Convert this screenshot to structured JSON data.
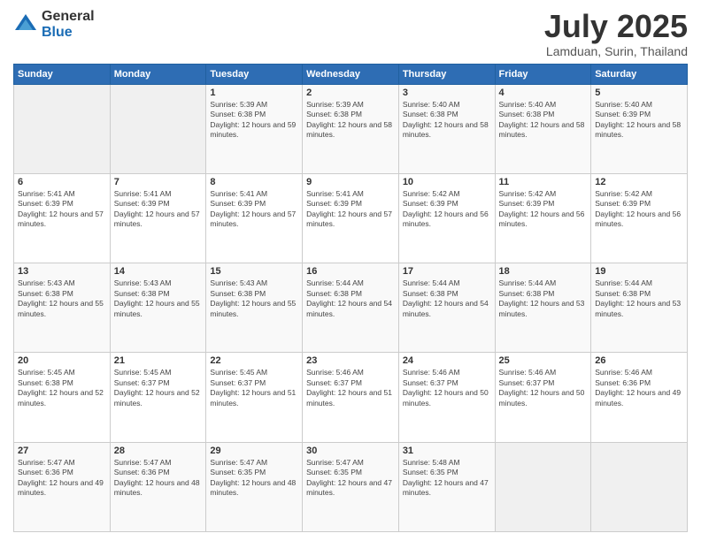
{
  "logo": {
    "general": "General",
    "blue": "Blue"
  },
  "header": {
    "month": "July 2025",
    "location": "Lamduan, Surin, Thailand"
  },
  "weekdays": [
    "Sunday",
    "Monday",
    "Tuesday",
    "Wednesday",
    "Thursday",
    "Friday",
    "Saturday"
  ],
  "weeks": [
    [
      {
        "day": "",
        "sunrise": "",
        "sunset": "",
        "daylight": ""
      },
      {
        "day": "",
        "sunrise": "",
        "sunset": "",
        "daylight": ""
      },
      {
        "day": "1",
        "sunrise": "Sunrise: 5:39 AM",
        "sunset": "Sunset: 6:38 PM",
        "daylight": "Daylight: 12 hours and 59 minutes."
      },
      {
        "day": "2",
        "sunrise": "Sunrise: 5:39 AM",
        "sunset": "Sunset: 6:38 PM",
        "daylight": "Daylight: 12 hours and 58 minutes."
      },
      {
        "day": "3",
        "sunrise": "Sunrise: 5:40 AM",
        "sunset": "Sunset: 6:38 PM",
        "daylight": "Daylight: 12 hours and 58 minutes."
      },
      {
        "day": "4",
        "sunrise": "Sunrise: 5:40 AM",
        "sunset": "Sunset: 6:38 PM",
        "daylight": "Daylight: 12 hours and 58 minutes."
      },
      {
        "day": "5",
        "sunrise": "Sunrise: 5:40 AM",
        "sunset": "Sunset: 6:39 PM",
        "daylight": "Daylight: 12 hours and 58 minutes."
      }
    ],
    [
      {
        "day": "6",
        "sunrise": "Sunrise: 5:41 AM",
        "sunset": "Sunset: 6:39 PM",
        "daylight": "Daylight: 12 hours and 57 minutes."
      },
      {
        "day": "7",
        "sunrise": "Sunrise: 5:41 AM",
        "sunset": "Sunset: 6:39 PM",
        "daylight": "Daylight: 12 hours and 57 minutes."
      },
      {
        "day": "8",
        "sunrise": "Sunrise: 5:41 AM",
        "sunset": "Sunset: 6:39 PM",
        "daylight": "Daylight: 12 hours and 57 minutes."
      },
      {
        "day": "9",
        "sunrise": "Sunrise: 5:41 AM",
        "sunset": "Sunset: 6:39 PM",
        "daylight": "Daylight: 12 hours and 57 minutes."
      },
      {
        "day": "10",
        "sunrise": "Sunrise: 5:42 AM",
        "sunset": "Sunset: 6:39 PM",
        "daylight": "Daylight: 12 hours and 56 minutes."
      },
      {
        "day": "11",
        "sunrise": "Sunrise: 5:42 AM",
        "sunset": "Sunset: 6:39 PM",
        "daylight": "Daylight: 12 hours and 56 minutes."
      },
      {
        "day": "12",
        "sunrise": "Sunrise: 5:42 AM",
        "sunset": "Sunset: 6:39 PM",
        "daylight": "Daylight: 12 hours and 56 minutes."
      }
    ],
    [
      {
        "day": "13",
        "sunrise": "Sunrise: 5:43 AM",
        "sunset": "Sunset: 6:38 PM",
        "daylight": "Daylight: 12 hours and 55 minutes."
      },
      {
        "day": "14",
        "sunrise": "Sunrise: 5:43 AM",
        "sunset": "Sunset: 6:38 PM",
        "daylight": "Daylight: 12 hours and 55 minutes."
      },
      {
        "day": "15",
        "sunrise": "Sunrise: 5:43 AM",
        "sunset": "Sunset: 6:38 PM",
        "daylight": "Daylight: 12 hours and 55 minutes."
      },
      {
        "day": "16",
        "sunrise": "Sunrise: 5:44 AM",
        "sunset": "Sunset: 6:38 PM",
        "daylight": "Daylight: 12 hours and 54 minutes."
      },
      {
        "day": "17",
        "sunrise": "Sunrise: 5:44 AM",
        "sunset": "Sunset: 6:38 PM",
        "daylight": "Daylight: 12 hours and 54 minutes."
      },
      {
        "day": "18",
        "sunrise": "Sunrise: 5:44 AM",
        "sunset": "Sunset: 6:38 PM",
        "daylight": "Daylight: 12 hours and 53 minutes."
      },
      {
        "day": "19",
        "sunrise": "Sunrise: 5:44 AM",
        "sunset": "Sunset: 6:38 PM",
        "daylight": "Daylight: 12 hours and 53 minutes."
      }
    ],
    [
      {
        "day": "20",
        "sunrise": "Sunrise: 5:45 AM",
        "sunset": "Sunset: 6:38 PM",
        "daylight": "Daylight: 12 hours and 52 minutes."
      },
      {
        "day": "21",
        "sunrise": "Sunrise: 5:45 AM",
        "sunset": "Sunset: 6:37 PM",
        "daylight": "Daylight: 12 hours and 52 minutes."
      },
      {
        "day": "22",
        "sunrise": "Sunrise: 5:45 AM",
        "sunset": "Sunset: 6:37 PM",
        "daylight": "Daylight: 12 hours and 51 minutes."
      },
      {
        "day": "23",
        "sunrise": "Sunrise: 5:46 AM",
        "sunset": "Sunset: 6:37 PM",
        "daylight": "Daylight: 12 hours and 51 minutes."
      },
      {
        "day": "24",
        "sunrise": "Sunrise: 5:46 AM",
        "sunset": "Sunset: 6:37 PM",
        "daylight": "Daylight: 12 hours and 50 minutes."
      },
      {
        "day": "25",
        "sunrise": "Sunrise: 5:46 AM",
        "sunset": "Sunset: 6:37 PM",
        "daylight": "Daylight: 12 hours and 50 minutes."
      },
      {
        "day": "26",
        "sunrise": "Sunrise: 5:46 AM",
        "sunset": "Sunset: 6:36 PM",
        "daylight": "Daylight: 12 hours and 49 minutes."
      }
    ],
    [
      {
        "day": "27",
        "sunrise": "Sunrise: 5:47 AM",
        "sunset": "Sunset: 6:36 PM",
        "daylight": "Daylight: 12 hours and 49 minutes."
      },
      {
        "day": "28",
        "sunrise": "Sunrise: 5:47 AM",
        "sunset": "Sunset: 6:36 PM",
        "daylight": "Daylight: 12 hours and 48 minutes."
      },
      {
        "day": "29",
        "sunrise": "Sunrise: 5:47 AM",
        "sunset": "Sunset: 6:35 PM",
        "daylight": "Daylight: 12 hours and 48 minutes."
      },
      {
        "day": "30",
        "sunrise": "Sunrise: 5:47 AM",
        "sunset": "Sunset: 6:35 PM",
        "daylight": "Daylight: 12 hours and 47 minutes."
      },
      {
        "day": "31",
        "sunrise": "Sunrise: 5:48 AM",
        "sunset": "Sunset: 6:35 PM",
        "daylight": "Daylight: 12 hours and 47 minutes."
      },
      {
        "day": "",
        "sunrise": "",
        "sunset": "",
        "daylight": ""
      },
      {
        "day": "",
        "sunrise": "",
        "sunset": "",
        "daylight": ""
      }
    ]
  ]
}
